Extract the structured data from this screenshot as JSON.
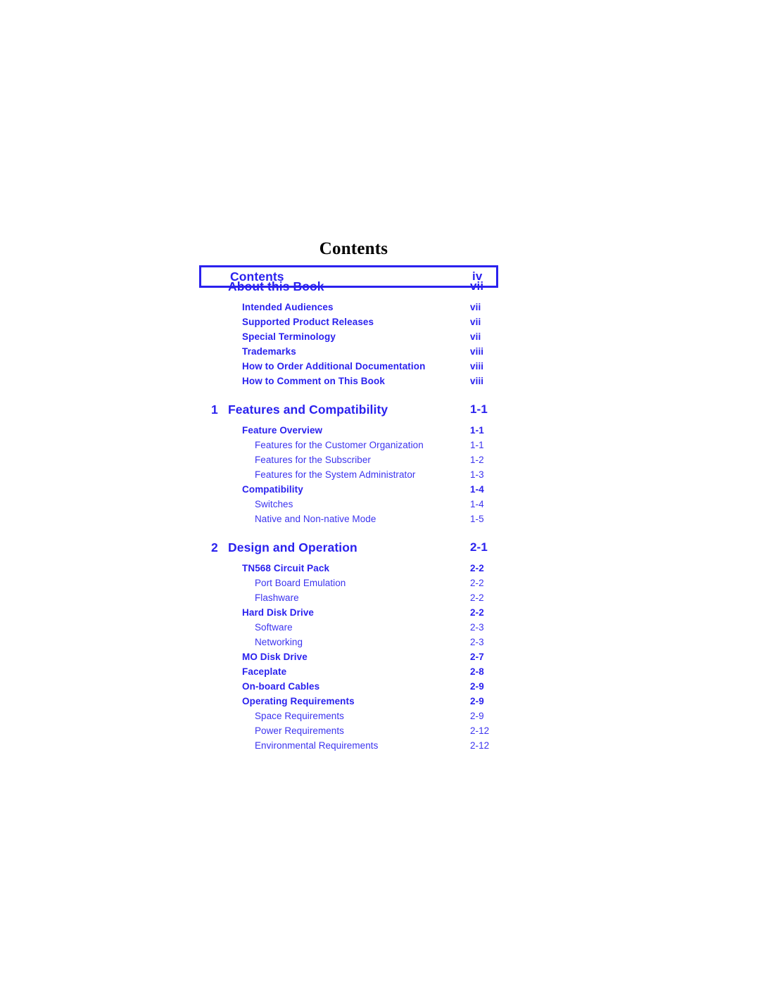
{
  "document": {
    "heading": "Contents",
    "accent_color": "#2a21ee",
    "heading_color": "#000000",
    "background_color": "#ffffff"
  },
  "toc": {
    "entries": [
      {
        "level": 0,
        "number": "",
        "label": "Contents",
        "page": "iv",
        "highlighted": true
      },
      {
        "level": 0,
        "number": "",
        "label": "About this Book",
        "page": "vii",
        "highlighted": false
      },
      {
        "level": 1,
        "number": "",
        "label": "Intended Audiences",
        "page": "vii",
        "highlighted": false
      },
      {
        "level": 1,
        "number": "",
        "label": "Supported Product Releases",
        "page": "vii",
        "highlighted": false
      },
      {
        "level": 1,
        "number": "",
        "label": "Special Terminology",
        "page": "vii",
        "highlighted": false
      },
      {
        "level": 1,
        "number": "",
        "label": "Trademarks",
        "page": "viii",
        "highlighted": false
      },
      {
        "level": 1,
        "number": "",
        "label": "How to Order Additional Documentation",
        "page": "viii",
        "highlighted": false
      },
      {
        "level": 1,
        "number": "",
        "label": "How to Comment on This Book",
        "page": "viii",
        "highlighted": false
      },
      {
        "level": 0,
        "number": "1",
        "label": "Features and Compatibility",
        "page": "1-1",
        "highlighted": false
      },
      {
        "level": 1,
        "number": "",
        "label": "Feature Overview",
        "page": "1-1",
        "highlighted": false
      },
      {
        "level": 2,
        "number": "",
        "label": "Features for the Customer Organization",
        "page": "1-1",
        "highlighted": false
      },
      {
        "level": 2,
        "number": "",
        "label": "Features for the Subscriber",
        "page": "1-2",
        "highlighted": false
      },
      {
        "level": 2,
        "number": "",
        "label": "Features for the System Administrator",
        "page": "1-3",
        "highlighted": false
      },
      {
        "level": 1,
        "number": "",
        "label": "Compatibility",
        "page": "1-4",
        "highlighted": false
      },
      {
        "level": 2,
        "number": "",
        "label": "Switches",
        "page": "1-4",
        "highlighted": false
      },
      {
        "level": 2,
        "number": "",
        "label": "Native and Non-native Mode",
        "page": "1-5",
        "highlighted": false
      },
      {
        "level": 0,
        "number": "2",
        "label": "Design and Operation",
        "page": "2-1",
        "highlighted": false
      },
      {
        "level": 1,
        "number": "",
        "label": "TN568 Circuit Pack",
        "page": "2-2",
        "highlighted": false
      },
      {
        "level": 2,
        "number": "",
        "label": "Port Board Emulation",
        "page": "2-2",
        "highlighted": false
      },
      {
        "level": 2,
        "number": "",
        "label": "Flashware",
        "page": "2-2",
        "highlighted": false
      },
      {
        "level": 1,
        "number": "",
        "label": "Hard Disk Drive",
        "page": "2-2",
        "highlighted": false
      },
      {
        "level": 2,
        "number": "",
        "label": "Software",
        "page": "2-3",
        "highlighted": false
      },
      {
        "level": 2,
        "number": "",
        "label": "Networking",
        "page": "2-3",
        "highlighted": false
      },
      {
        "level": 1,
        "number": "",
        "label": "MO Disk Drive",
        "page": "2-7",
        "highlighted": false
      },
      {
        "level": 1,
        "number": "",
        "label": "Faceplate",
        "page": "2-8",
        "highlighted": false
      },
      {
        "level": 1,
        "number": "",
        "label": "On-board Cables",
        "page": "2-9",
        "highlighted": false
      },
      {
        "level": 1,
        "number": "",
        "label": "Operating Requirements",
        "page": "2-9",
        "highlighted": false
      },
      {
        "level": 2,
        "number": "",
        "label": "Space Requirements",
        "page": "2-9",
        "highlighted": false
      },
      {
        "level": 2,
        "number": "",
        "label": "Power Requirements",
        "page": "2-12",
        "highlighted": false
      },
      {
        "level": 2,
        "number": "",
        "label": "Environmental Requirements",
        "page": "2-12",
        "highlighted": false
      }
    ]
  }
}
